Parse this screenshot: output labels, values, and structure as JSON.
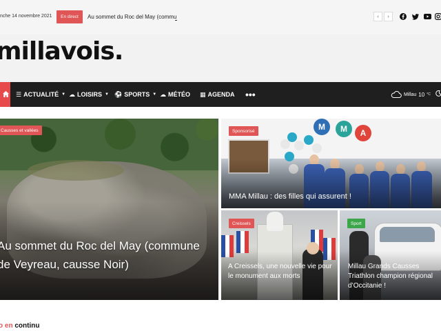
{
  "topbar": {
    "date": "nche 14 novembre 2021",
    "live_label": "En direct",
    "ticker_text": "Au sommet du Roc del May (commu",
    "arrow_prev": "‹",
    "arrow_next": "›",
    "social": [
      "facebook-icon",
      "twitter-icon",
      "youtube-icon",
      "instagram-icon"
    ]
  },
  "logo": {
    "text": "millavois",
    "dot": "."
  },
  "nav": {
    "home_icon": "home-icon",
    "items": [
      {
        "label": "ACTUALITÉ",
        "icon": "☰",
        "caret": true
      },
      {
        "label": "LOISIRS",
        "icon": "☁",
        "caret": true
      },
      {
        "label": "SPORTS",
        "icon": "⚽",
        "caret": true
      },
      {
        "label": "MÉTÉO",
        "icon": "☁",
        "caret": false
      },
      {
        "label": "AGENDA",
        "icon": "▦",
        "caret": false
      }
    ],
    "more": "•••",
    "weather": {
      "city": "Millau",
      "temp": "10",
      "unit": "°C"
    }
  },
  "cards": {
    "big": {
      "category": "Causses et vallées",
      "title": "Au sommet du Roc del May (commune de Veyreau, causse Noir)"
    },
    "mma": {
      "category": "Sponsorisé",
      "title": "MMA Millau : des filles qui assurent !"
    },
    "creissels": {
      "category": "Creissels",
      "title": "A Creissels, une nouvelle vie pour le monument aux morts"
    },
    "sport": {
      "category": "Sport",
      "title": "Millau Grands Causses Triathlon champion régional d’Occitanie !"
    }
  },
  "section": {
    "prefix": "o en",
    "suffix": "continu"
  },
  "colors": {
    "accent": "#e05555",
    "nav_bg": "#1f1f1f",
    "sport_badge": "#3da64a"
  }
}
